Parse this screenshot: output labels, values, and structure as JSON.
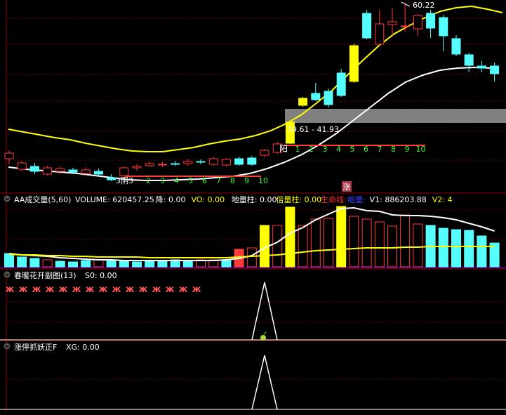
{
  "colors": {
    "background": "#000000",
    "grid": "#7a0000",
    "panel_border": "#8b0000",
    "up": "#ff3b3b",
    "down": "#55ffff",
    "yellow": "#ffff00",
    "white": "#ffffff",
    "gray_band": "#808080",
    "green_text": "#33ff33",
    "red_text": "#ff2a2a",
    "blue_text": "#3344ff",
    "purple_line": "#6600aa"
  },
  "price_panel": {
    "peak_label": "60.22",
    "range_label": "39.61 - 41.93",
    "rise_marker": "涨",
    "sequence_a": {
      "prefix": "阴",
      "labels": [
        "3",
        "2",
        "3",
        "4",
        "5",
        "6",
        "7",
        "8",
        "9",
        "10"
      ],
      "mixed_label": "3阴3"
    },
    "sequence_b": {
      "prefix": "阳",
      "labels": [
        "1",
        "2",
        "3",
        "4",
        "5",
        "6",
        "7",
        "8",
        "9",
        "10"
      ]
    }
  },
  "volume_panel": {
    "collapse_icon": "chevron-down-icon",
    "title": "AA成交量(5,60)",
    "indicators": [
      {
        "label": "VOLUME: 620457.25",
        "color": "#ffffff"
      },
      {
        "label": "降: 0.00",
        "color": "#ffffff"
      },
      {
        "label": "VO: 0.00",
        "color": "#ffff00"
      },
      {
        "label": "地量柱: 0.00",
        "color": "#ffffff"
      },
      {
        "label": "倍量柱: 0.00",
        "color": "#ffff00"
      },
      {
        "label": "生命线: ",
        "color": "#ff2a2a"
      },
      {
        "label": "缩量: ",
        "color": "#3344ff"
      },
      {
        "label": "V1: 886203.88",
        "color": "#ffffff"
      },
      {
        "label": "V2: 4",
        "color": "#ffff00"
      }
    ]
  },
  "spring_panel": {
    "collapse_icon": "chevron-down-icon",
    "title": "春暖花开副图(13)",
    "value_label": "S0: 0.00",
    "butterfly_icon": "butterfly-icon",
    "butterfly_glyph": "ж",
    "butterfly_count": 15,
    "apple_icon": "apple-icon"
  },
  "limit_panel": {
    "collapse_icon": "chevron-down-icon",
    "title": "涨停抓妖正F",
    "value_label": "XG: 0.00"
  },
  "chart_data": {
    "type": "candlestick",
    "series_candles": [
      {
        "o": 226,
        "c": 218,
        "h": 214,
        "l": 233
      },
      {
        "o": 241,
        "c": 232,
        "h": 229,
        "l": 244
      },
      {
        "o": 237,
        "c": 244,
        "h": 232,
        "l": 248
      },
      {
        "o": 248,
        "c": 239,
        "h": 236,
        "l": 250
      },
      {
        "o": 244,
        "c": 240,
        "h": 237,
        "l": 248
      },
      {
        "o": 242,
        "c": 245,
        "h": 239,
        "l": 248
      },
      {
        "o": 247,
        "c": 242,
        "h": 238,
        "l": 249
      },
      {
        "o": 244,
        "c": 248,
        "h": 240,
        "l": 251
      },
      {
        "o": 253,
        "c": 256,
        "h": 248,
        "l": 258
      },
      {
        "o": 250,
        "c": 239,
        "h": 237,
        "l": 254
      },
      {
        "o": 239,
        "c": 237,
        "h": 234,
        "l": 243
      },
      {
        "o": 236,
        "c": 233,
        "h": 230,
        "l": 238
      },
      {
        "o": 235,
        "c": 234,
        "h": 230,
        "l": 238
      },
      {
        "o": 233,
        "c": 233,
        "h": 229,
        "l": 236
      },
      {
        "o": 233,
        "c": 230,
        "h": 226,
        "l": 236
      },
      {
        "o": 230,
        "c": 231,
        "h": 227,
        "l": 234
      },
      {
        "o": 234,
        "c": 226,
        "h": 223,
        "l": 236
      },
      {
        "o": 235,
        "c": 227,
        "h": 225,
        "l": 237
      },
      {
        "o": 226,
        "c": 234,
        "h": 223,
        "l": 236
      },
      {
        "o": 225,
        "c": 234,
        "h": 222,
        "l": 236
      },
      {
        "o": 221,
        "c": 214,
        "h": 212,
        "l": 224
      },
      {
        "o": 217,
        "c": 205,
        "h": 202,
        "l": 219
      },
      {
        "o": 204,
        "c": 174,
        "h": 172,
        "l": 205
      },
      {
        "o": 140,
        "c": 150,
        "h": 138,
        "l": 152
      },
      {
        "o": 133,
        "c": 142,
        "h": 118,
        "l": 144
      },
      {
        "o": 130,
        "c": 149,
        "h": 126,
        "l": 153
      },
      {
        "o": 104,
        "c": 136,
        "h": 98,
        "l": 138
      },
      {
        "o": 65,
        "c": 116,
        "h": 62,
        "l": 118
      },
      {
        "o": 19,
        "c": 54,
        "h": 14,
        "l": 56
      },
      {
        "o": 63,
        "c": 34,
        "h": 14,
        "l": 66
      },
      {
        "o": 35,
        "c": 31,
        "h": 12,
        "l": 52
      },
      {
        "o": 38,
        "c": 37,
        "h": 5,
        "l": 45
      },
      {
        "o": 41,
        "c": 22,
        "h": 20,
        "l": 51
      },
      {
        "o": 19,
        "c": 40,
        "h": 14,
        "l": 54
      },
      {
        "o": 25,
        "c": 51,
        "h": 21,
        "l": 73
      },
      {
        "o": 55,
        "c": 77,
        "h": 50,
        "l": 80
      },
      {
        "o": 78,
        "c": 93,
        "h": 75,
        "l": 103
      },
      {
        "o": 94,
        "c": 97,
        "h": 87,
        "l": 103
      },
      {
        "o": 94,
        "c": 105,
        "h": 89,
        "l": 116
      }
    ],
    "ma_yellow": [
      184,
      188,
      192,
      196,
      199,
      204,
      208,
      212,
      215,
      216,
      216,
      213,
      210,
      205,
      201,
      198,
      193,
      186,
      176,
      163,
      146,
      128,
      106,
      85,
      65,
      48,
      36,
      25,
      16,
      11,
      9,
      13,
      18
    ],
    "ma_white": [
      238,
      241,
      243,
      245,
      247,
      250,
      253,
      256,
      257,
      257,
      256,
      255,
      253,
      251,
      247,
      240,
      231,
      220,
      206,
      190,
      171,
      152,
      133,
      117,
      107,
      100,
      97,
      96,
      97
    ],
    "volume_bars": [
      {
        "v": 19,
        "up": false
      },
      {
        "v": 14,
        "up": false
      },
      {
        "v": 12,
        "up": false
      },
      {
        "v": 10,
        "up": true
      },
      {
        "v": 8,
        "up": false
      },
      {
        "v": 7,
        "up": false
      },
      {
        "v": 9,
        "up": false
      },
      {
        "v": 10,
        "up": true
      },
      {
        "v": 10,
        "up": false
      },
      {
        "v": 8,
        "up": false
      },
      {
        "v": 7,
        "up": false
      },
      {
        "v": 8,
        "up": false
      },
      {
        "v": 9,
        "up": false
      },
      {
        "v": 10,
        "up": false
      },
      {
        "v": 9,
        "up": false
      },
      {
        "v": 10,
        "up": true
      },
      {
        "v": 10,
        "up": true
      },
      {
        "v": 10,
        "up": false
      },
      {
        "v": 25,
        "up": true,
        "solid": true
      },
      {
        "v": 27,
        "up": true
      },
      {
        "v": 59,
        "up": true,
        "yellow": true
      },
      {
        "v": 59,
        "up": true
      },
      {
        "v": 85,
        "up": true,
        "yellow": true
      },
      {
        "v": 59,
        "up": true
      },
      {
        "v": 68,
        "up": true
      },
      {
        "v": 69,
        "up": true
      },
      {
        "v": 86,
        "up": true,
        "yellow": true
      },
      {
        "v": 72,
        "up": true
      },
      {
        "v": 68,
        "up": true
      },
      {
        "v": 64,
        "up": true
      },
      {
        "v": 58,
        "up": true
      },
      {
        "v": 74,
        "up": true
      },
      {
        "v": 61,
        "up": true
      },
      {
        "v": 59,
        "up": false
      },
      {
        "v": 55,
        "up": false
      },
      {
        "v": 53,
        "up": false
      },
      {
        "v": 52,
        "up": false
      },
      {
        "v": 44,
        "up": false
      },
      {
        "v": 34,
        "up": false
      }
    ],
    "volume_line_white": [
      19,
      17,
      16,
      15,
      13,
      12,
      11,
      10,
      10,
      9,
      9,
      9,
      9,
      9,
      9,
      9,
      9,
      10,
      12,
      16,
      27,
      35,
      48,
      56,
      67,
      75,
      83,
      84,
      80,
      79,
      74,
      73,
      73,
      72,
      70,
      67,
      62,
      57,
      51
    ],
    "volume_line_yellow": [
      18,
      17,
      17,
      16,
      16,
      15,
      15,
      14,
      14,
      14,
      14,
      13,
      13,
      13,
      13,
      13,
      13,
      13,
      14,
      15,
      16,
      17,
      19,
      21,
      23,
      24,
      25,
      26,
      27,
      27,
      27,
      28,
      28,
      29,
      29,
      29,
      29,
      29,
      29
    ],
    "signal_peak_index": 20
  }
}
